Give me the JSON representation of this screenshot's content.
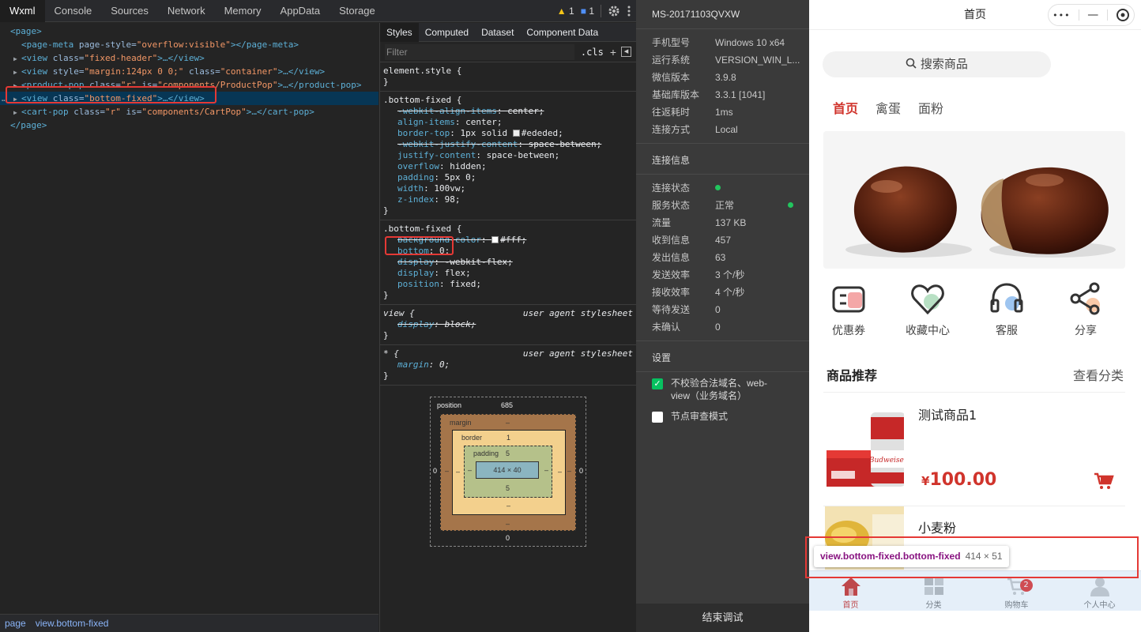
{
  "devtools": {
    "tabs": [
      "Wxml",
      "Console",
      "Sources",
      "Network",
      "Memory",
      "AppData",
      "Storage"
    ],
    "warn_count": "1",
    "msg_count": "1",
    "tree": {
      "l0_tag": "<page>",
      "l1_tag": "<page-meta",
      "l1_attr": " page-style=",
      "l1_val": "\"overflow:visible\"",
      "l1_close": "></page-meta>",
      "l2_tag": "<view",
      "l2_attr": " class=",
      "l2_val": "\"fixed-header\"",
      "l2_close": ">…</view>",
      "l3_tag": "<view",
      "l3_attr1": " style=",
      "l3_val1": "\"margin:124px 0 0;\"",
      "l3_attr2": " class=",
      "l3_val2": "\"container\"",
      "l3_close": ">…</view>",
      "l4_tag": "<product-pop",
      "l4_attr1": " class=",
      "l4_val1": "\"r\"",
      "l4_attr2": " is=",
      "l4_val2": "\"components/ProductPop\"",
      "l4_close": ">…</product-pop>",
      "l5_tag": "<view",
      "l5_attr": " class=",
      "l5_val": "\"bottom-fixed\"",
      "l5_close": ">…</view>",
      "l6_tag": "<cart-pop",
      "l6_attr1": " class=",
      "l6_val1": "\"r\"",
      "l6_attr2": " is=",
      "l6_val2": "\"components/CartPop\"",
      "l6_close": ">…</cart-pop>",
      "l7_tag": "</page>"
    },
    "breadcrumb": [
      "page",
      "view.bottom-fixed"
    ]
  },
  "styles": {
    "tabs": [
      "Styles",
      "Computed",
      "Dataset",
      "Component Data"
    ],
    "filter_placeholder": "Filter",
    "cls": ".cls",
    "element_style": "element.style {",
    "close": "}",
    "rule1": {
      "selector": ".bottom-fixed {",
      "p1": "-webkit-align-items",
      "v1": "center;",
      "p2": "align-items",
      "v2": "center;",
      "p3": "border-top",
      "v3": "1px solid",
      "v3b": "#ededed;",
      "p4": "-webkit-justify-content",
      "v4": "space-between;",
      "p5": "justify-content",
      "v5": "space-between;",
      "p6": "overflow",
      "v6": "hidden;",
      "p7": "padding",
      "v7": "5px 0;",
      "p8": "width",
      "v8": "100vw;",
      "p9": "z-index",
      "v9": "98;"
    },
    "rule2": {
      "selector": ".bottom-fixed {",
      "p1": "background-color",
      "v1": "#fff;",
      "p2": "bottom",
      "v2": "0;",
      "p3": "display",
      "v3": "-webkit-flex;",
      "p4": "display",
      "v4": "flex;",
      "p5": "position",
      "v5": "fixed;"
    },
    "rule3": {
      "selector": "view {",
      "source": "user agent stylesheet",
      "p1": "display",
      "v1": "block;"
    },
    "rule4": {
      "selector": "* {",
      "source": "user agent stylesheet",
      "p1": "margin",
      "v1": "0;"
    },
    "box_model": {
      "position_label": "position",
      "position_val": "685",
      "margin_label": "margin",
      "border_label": "border",
      "border_val": "1",
      "padding_label": "padding",
      "padding_top": "5",
      "padding_bottom": "5",
      "content": "414 × 40",
      "dash": "–",
      "left": "0",
      "right": "0",
      "bottom": "0"
    }
  },
  "debug": {
    "device_id": "MS-20171103QVXW",
    "info": [
      {
        "k": "手机型号",
        "v": "Windows 10 x64"
      },
      {
        "k": "运行系统",
        "v": "VERSION_WIN_L..."
      },
      {
        "k": "微信版本",
        "v": "3.9.8"
      },
      {
        "k": "基础库版本",
        "v": "3.3.1 [1041]"
      },
      {
        "k": "往返耗时",
        "v": "1ms"
      },
      {
        "k": "连接方式",
        "v": "Local"
      }
    ],
    "conn_section": "连接信息",
    "conn": [
      {
        "k": "连接状态",
        "v": ""
      },
      {
        "k": "服务状态",
        "v": "正常"
      },
      {
        "k": "流量",
        "v": "137 KB"
      },
      {
        "k": "收到信息",
        "v": "457"
      },
      {
        "k": "发出信息",
        "v": "63"
      },
      {
        "k": "发送效率",
        "v": "3 个/秒"
      },
      {
        "k": "接收效率",
        "v": "4 个/秒"
      },
      {
        "k": "等待发送",
        "v": "0"
      },
      {
        "k": "未确认",
        "v": "0"
      }
    ],
    "settings_section": "设置",
    "check1": "不校验合法域名、web-view（业务域名）",
    "check2": "节点审查模式",
    "end_button": "结束调试"
  },
  "sim": {
    "title": "首页",
    "capsule_more": "•••",
    "capsule_min": "—",
    "search_placeholder": "搜索商品",
    "search_icon": "search-icon",
    "tabs": [
      "首页",
      "禽蛋",
      "面粉"
    ],
    "icons": [
      {
        "label": "优惠券",
        "icon": "coupon-icon"
      },
      {
        "label": "收藏中心",
        "icon": "heart-icon"
      },
      {
        "label": "客服",
        "icon": "headset-icon"
      },
      {
        "label": "分享",
        "icon": "share-icon"
      }
    ],
    "rec_title": "商品推荐",
    "rec_more": "查看分类",
    "products": [
      {
        "name": "测试商品1",
        "currency": "¥",
        "price": "100.00"
      },
      {
        "name": "小麦粉"
      }
    ],
    "tabbar": [
      {
        "label": "首页",
        "icon": "home-icon"
      },
      {
        "label": "分类",
        "icon": "category-icon"
      },
      {
        "label": "购物车",
        "icon": "cart-icon",
        "badge": "2"
      },
      {
        "label": "个人中心",
        "icon": "user-icon"
      }
    ],
    "tooltip_selector": "view.bottom-fixed.bottom-fixed",
    "tooltip_size": "414 × 51",
    "accent": "#d0342c"
  }
}
